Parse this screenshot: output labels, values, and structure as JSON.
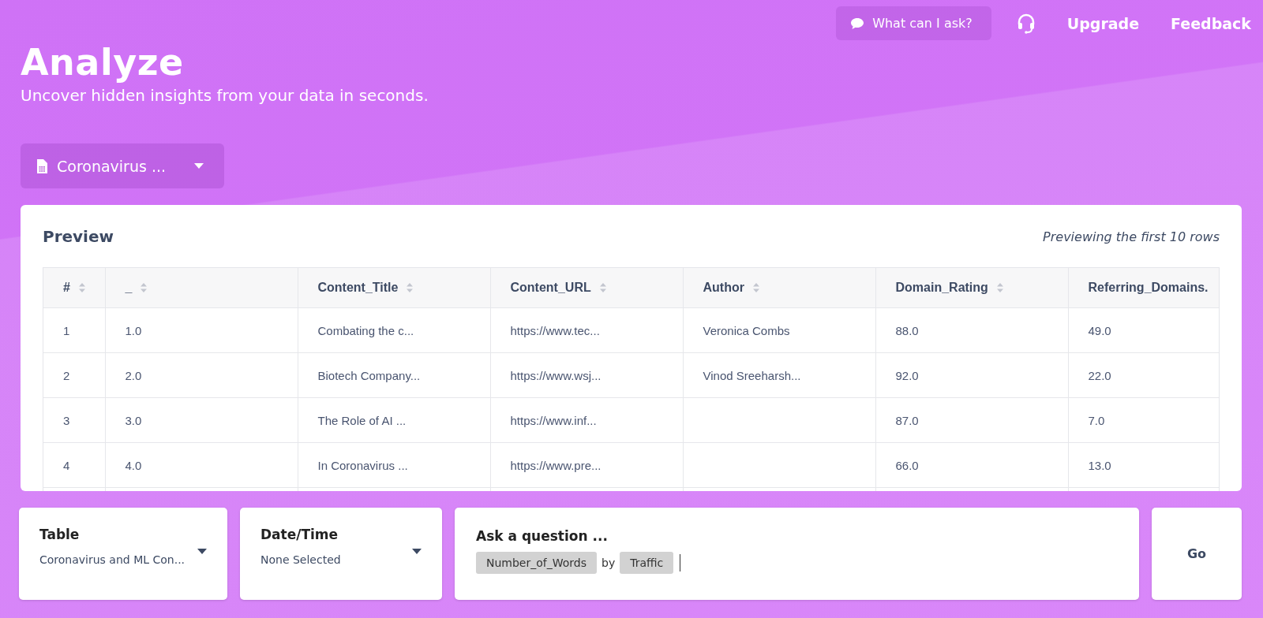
{
  "header": {
    "help_button": "What can I ask?",
    "links": [
      "Upgrade",
      "Feedback"
    ]
  },
  "title": "Analyze",
  "subtitle": "Uncover hidden insights from your data in seconds.",
  "dataset_dropdown": {
    "value": "Coronavirus ..."
  },
  "preview": {
    "title": "Preview",
    "note": "Previewing the first 10 rows",
    "columns": [
      {
        "label": "#",
        "sortable": true
      },
      {
        "label": "_",
        "sortable": true
      },
      {
        "label": "Content_Title",
        "sortable": true
      },
      {
        "label": "Content_URL",
        "sortable": true
      },
      {
        "label": "Author",
        "sortable": true
      },
      {
        "label": "Domain_Rating",
        "sortable": true
      },
      {
        "label": "Referring_Domains.",
        "sortable": false
      }
    ],
    "rows": [
      [
        "1",
        "1.0",
        "Combating the c...",
        "https://www.tec...",
        "Veronica Combs",
        "88.0",
        "49.0"
      ],
      [
        "2",
        "2.0",
        "Biotech Company...",
        "https://www.wsj...",
        "Vinod Sreeharsh...",
        "92.0",
        "22.0"
      ],
      [
        "3",
        "3.0",
        "The Role of AI ...",
        "https://www.inf...",
        "",
        "87.0",
        "7.0"
      ],
      [
        "4",
        "4.0",
        "In Coronavirus ...",
        "https://www.pre...",
        "",
        "66.0",
        "13.0"
      ]
    ]
  },
  "selectors": [
    {
      "label": "Table",
      "value": "Coronavirus and ML Con..."
    },
    {
      "label": "Date/Time",
      "value": "None Selected"
    }
  ],
  "question": {
    "label": "Ask a question ...",
    "tokens": [
      {
        "kind": "chip",
        "text": "Number_of_Words"
      },
      {
        "kind": "word",
        "text": "by"
      },
      {
        "kind": "chip",
        "text": "Traffic"
      }
    ]
  },
  "go_button": "Go"
}
